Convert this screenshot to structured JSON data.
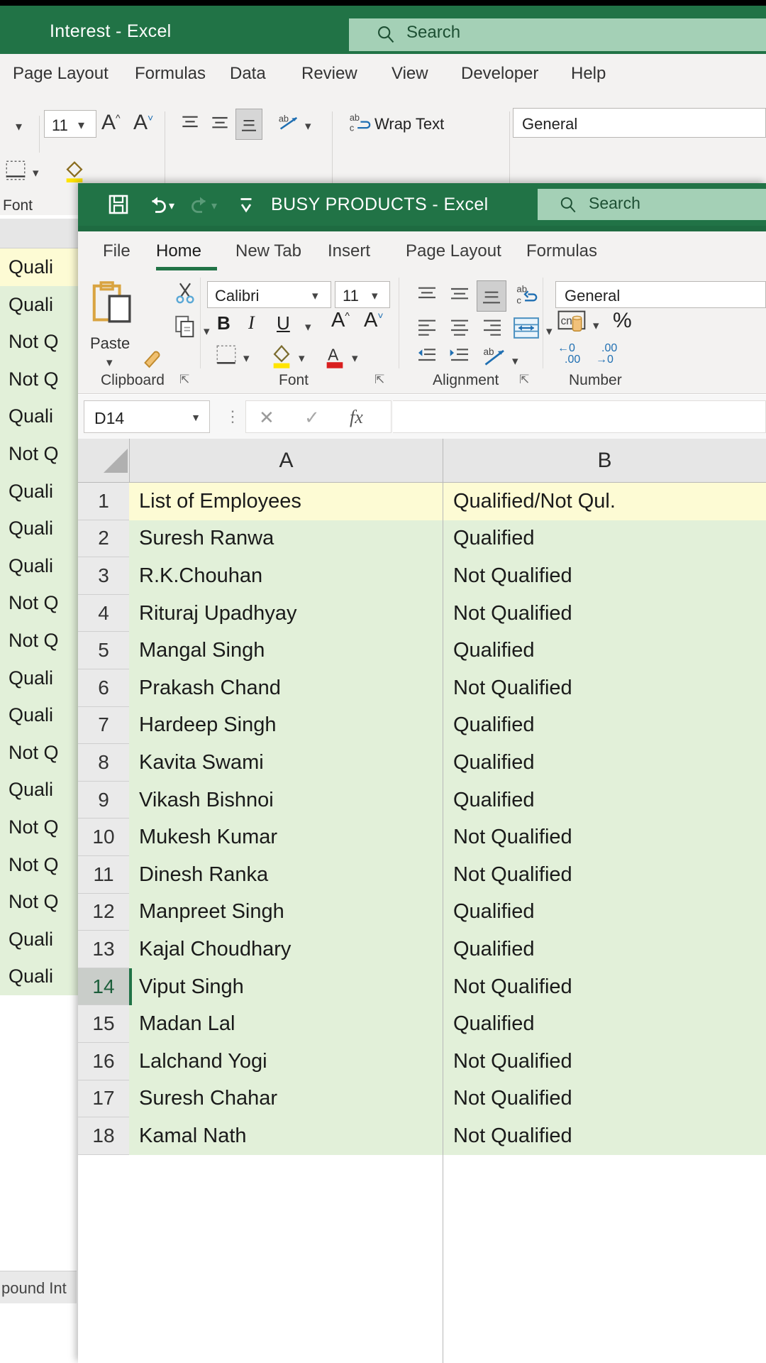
{
  "background_window": {
    "title": "Interest  -  Excel",
    "search": {
      "placeholder": "Search",
      "icon": "search-icon"
    },
    "tabs": [
      "Page Layout",
      "Formulas",
      "Data",
      "Review",
      "View",
      "Developer",
      "Help"
    ],
    "font_size": "11",
    "wrap_text": "Wrap Text",
    "number_format": "General",
    "font_group_label": "Font",
    "sheet_tab": "pound Int",
    "column_b_values": [
      "Quali",
      "Quali",
      "Not Q",
      "Not Q",
      "Quali",
      "Not Q",
      "Quali",
      "Quali",
      "Quali",
      "Not Q",
      "Not Q",
      "Quali",
      "Quali",
      "Not Q",
      "Quali",
      "Not Q",
      "Not Q",
      "Not Q",
      "Quali",
      "Quali"
    ]
  },
  "front_window": {
    "title": "BUSY PRODUCTS  -  Excel",
    "quick_access": [
      {
        "name": "save-icon",
        "label": "Save"
      },
      {
        "name": "undo-icon",
        "label": "Undo"
      },
      {
        "name": "redo-icon",
        "label": "Redo"
      },
      {
        "name": "customize-qat-icon",
        "label": "Customize Quick Access Toolbar"
      }
    ],
    "search": {
      "placeholder": "Search",
      "icon": "search-icon"
    },
    "tabs": [
      {
        "label": "File",
        "active": false
      },
      {
        "label": "Home",
        "active": true
      },
      {
        "label": "New Tab",
        "active": false
      },
      {
        "label": "Insert",
        "active": false
      },
      {
        "label": "Page Layout",
        "active": false
      },
      {
        "label": "Formulas",
        "active": false
      }
    ],
    "ribbon": {
      "clipboard": {
        "group_label": "Clipboard",
        "paste_label": "Paste",
        "icons": [
          "paste-icon",
          "cut-icon",
          "copy-icon",
          "format-painter-icon"
        ]
      },
      "font": {
        "group_label": "Font",
        "font_name": "Calibri",
        "font_size": "11",
        "bold": "B",
        "italic": "I",
        "underline": "U",
        "grow_font": "A",
        "shrink_font": "A",
        "icons": [
          "borders-icon",
          "fill-color-icon",
          "font-color-icon"
        ]
      },
      "alignment": {
        "group_label": "Alignment",
        "icons": [
          "align-top-icon",
          "align-middle-icon",
          "align-bottom-icon",
          "wrap-text-icon",
          "align-left-icon",
          "align-center-icon",
          "align-right-icon",
          "merge-center-icon",
          "decrease-indent-icon",
          "increase-indent-icon",
          "orientation-icon"
        ]
      },
      "number": {
        "group_label": "Number",
        "format": "General",
        "percent": "%",
        "icons": [
          "accounting-format-icon",
          "percent-style-icon",
          "increase-decimal-icon",
          "decrease-decimal-icon"
        ]
      }
    },
    "formula_bar": {
      "name_box": "D14",
      "cancel_icon": "cancel-icon",
      "enter_icon": "enter-icon",
      "fx_icon": "insert-function-icon",
      "value": ""
    },
    "sheet": {
      "columns": [
        "A",
        "B"
      ],
      "selected_cell": "D14",
      "selected_row": 14,
      "rows": [
        {
          "num": "1",
          "a": "List of Employees",
          "b": "Qualified/Not Qul.",
          "header": true
        },
        {
          "num": "2",
          "a": "Suresh Ranwa",
          "b": "Qualified"
        },
        {
          "num": "3",
          "a": "R.K.Chouhan",
          "b": "Not Qualified"
        },
        {
          "num": "4",
          "a": "Rituraj Upadhyay",
          "b": "Not Qualified"
        },
        {
          "num": "5",
          "a": "Mangal Singh",
          "b": "Qualified"
        },
        {
          "num": "6",
          "a": "Prakash Chand",
          "b": "Not Qualified"
        },
        {
          "num": "7",
          "a": "Hardeep Singh",
          "b": "Qualified"
        },
        {
          "num": "8",
          "a": "Kavita Swami",
          "b": "Qualified"
        },
        {
          "num": "9",
          "a": "Vikash Bishnoi",
          "b": "Qualified"
        },
        {
          "num": "10",
          "a": "Mukesh Kumar",
          "b": "Not Qualified"
        },
        {
          "num": "11",
          "a": "Dinesh Ranka",
          "b": "Not Qualified"
        },
        {
          "num": "12",
          "a": "Manpreet Singh",
          "b": "Qualified"
        },
        {
          "num": "13",
          "a": "Kajal Choudhary",
          "b": "Qualified"
        },
        {
          "num": "14",
          "a": "Viput Singh",
          "b": "Not Qualified",
          "selected": true
        },
        {
          "num": "15",
          "a": "Madan Lal",
          "b": "Qualified"
        },
        {
          "num": "16",
          "a": "Lalchand Yogi",
          "b": "Not Qualified"
        },
        {
          "num": "17",
          "a": "Suresh Chahar",
          "b": "Not Qualified"
        },
        {
          "num": "18",
          "a": "Kamal Nath",
          "b": "Not Qualified"
        }
      ]
    }
  },
  "colors": {
    "excel_green": "#217346",
    "header_yellow": "#fdfbd4",
    "body_green": "#e2f0d9",
    "ribbon_gray": "#f3f2f1"
  }
}
